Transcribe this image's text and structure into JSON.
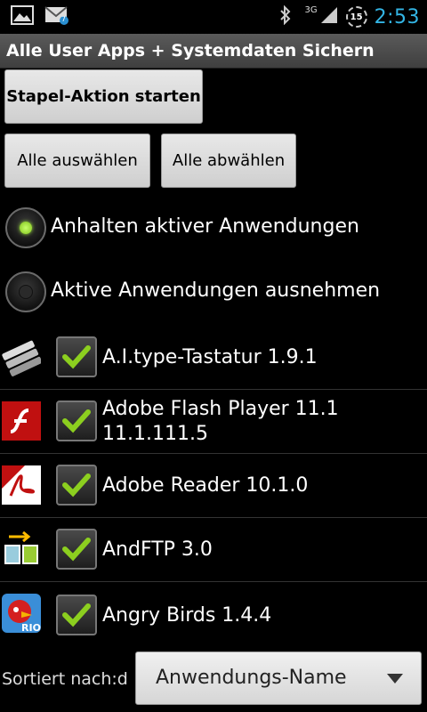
{
  "status_bar": {
    "time": "2:53",
    "network": "3G",
    "badge_count": "15",
    "icons": [
      "image-icon",
      "mail-icon",
      "bluetooth-icon",
      "signal-icon",
      "battery-icon"
    ]
  },
  "title": "Alle User Apps + Systemdaten Sichern",
  "buttons": {
    "stapel": "Stapel-Aktion starten",
    "select_all": "Alle auswählen",
    "deselect_all": "Alle abwählen"
  },
  "radios": [
    {
      "label": "Anhalten aktiver Anwendungen",
      "checked": true
    },
    {
      "label": "Aktive Anwendungen ausnehmen",
      "checked": false
    }
  ],
  "apps": [
    {
      "name": "A.I.type-Tastatur 1.9.1",
      "checked": true,
      "icon": "keyboard-icon"
    },
    {
      "name": "Adobe Flash Player 11.1 11.1.111.5",
      "checked": true,
      "icon": "flash-icon"
    },
    {
      "name": "Adobe Reader 10.1.0",
      "checked": true,
      "icon": "acrobat-icon"
    },
    {
      "name": "AndFTP 3.0",
      "checked": true,
      "icon": "ftp-icon"
    },
    {
      "name": "Angry Birds 1.4.4",
      "checked": true,
      "icon": "angry-bird-icon"
    }
  ],
  "sort": {
    "label": "Sortiert nach:d",
    "value": "Anwendungs-Name"
  },
  "colors": {
    "clock": "#33b5e5",
    "check": "#8ccf1f",
    "radio_on": "#9be03a"
  }
}
